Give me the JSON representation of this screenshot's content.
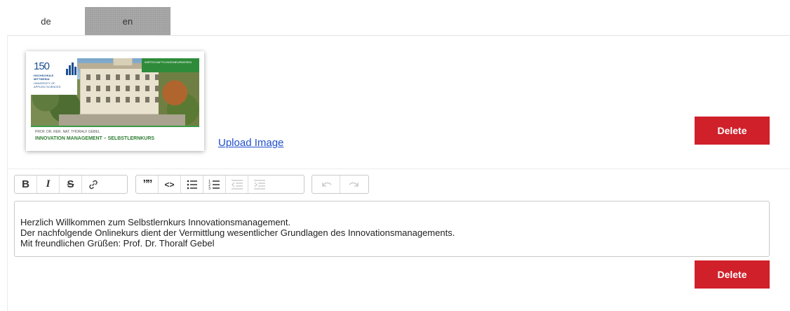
{
  "tabs": [
    {
      "label": "de",
      "active": true
    },
    {
      "label": "en",
      "active": false
    }
  ],
  "image": {
    "logo_number": "150",
    "logo_lines": [
      "HOCHSCHULE",
      "MITTWEIDA",
      "UNIVERSITY OF",
      "APPLIED SCIENCES"
    ],
    "badge_text": "WIRTSCHAFTS-INGENIEURWESEN",
    "caption_author": "PROF. DR. RER. NAT. THORALF GEBEL",
    "caption_title": "INNOVATION MANAGEMENT – SELBSTLERNKURS"
  },
  "upload_link": "Upload Image",
  "buttons": {
    "delete_image": "Delete",
    "delete_text": "Delete"
  },
  "toolbar": {
    "groups": [
      [
        "bold-icon",
        "italic-icon",
        "strikethrough-icon",
        "link-icon"
      ],
      [
        "blockquote-icon",
        "code-icon",
        "bullet-list-icon",
        "numbered-list-icon",
        "outdent-icon",
        "indent-icon"
      ],
      [
        "undo-icon",
        "redo-icon"
      ]
    ],
    "bold_glyph": "B",
    "italic_glyph": "I",
    "strike_glyph": "S",
    "quote_glyph": "””",
    "code_glyph": "<>"
  },
  "editor": {
    "lines": [
      "Herzlich Willkommen zum Selbstlernkurs Innovationsmanagement.",
      "Der nachfolgende Onlinekurs dient der Vermittlung wesentlicher Grundlagen des Innovationsmanagements.",
      "Mit freundlichen Grüßen: Prof. Dr. Thoralf Gebel"
    ]
  },
  "colors": {
    "delete_button": "#d0202a",
    "link": "#1f4fcc",
    "inactive_tab": "#a9a9a9"
  }
}
